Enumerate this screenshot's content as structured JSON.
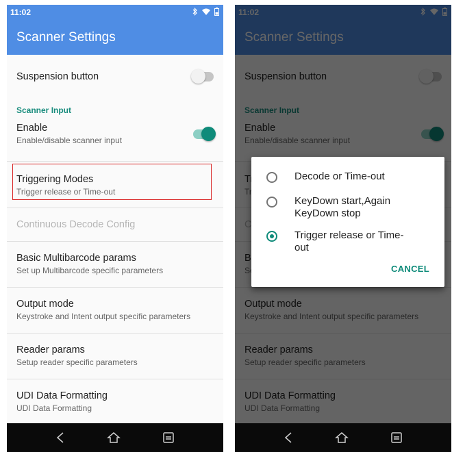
{
  "status_bar": {
    "time": "11:02",
    "icons": [
      "bluetooth-icon",
      "wifi-icon",
      "battery-icon"
    ]
  },
  "app_bar": {
    "title": "Scanner Settings"
  },
  "settings": {
    "suspension": {
      "title": "Suspension button",
      "enabled": false
    },
    "section_scanner_input": "Scanner Input",
    "enable": {
      "title": "Enable",
      "summary": "Enable/disable scanner input",
      "enabled": true
    },
    "triggering": {
      "title": "Triggering Modes",
      "summary": "Trigger release or Time-out"
    },
    "continuous": {
      "title": "Continuous Decode Config"
    },
    "multibarcode": {
      "title": "Basic Multibarcode params",
      "summary": "Set up Multibarcode specific parameters"
    },
    "output": {
      "title": "Output mode",
      "summary": "Keystroke and Intent output specific parameters"
    },
    "reader": {
      "title": "Reader params",
      "summary": "Setup reader specific parameters"
    },
    "udi": {
      "title": "UDI Data Formatting",
      "summary": "UDI Data Formatting"
    }
  },
  "dialog": {
    "options": [
      {
        "label": "Decode or Time-out",
        "selected": false
      },
      {
        "label": "KeyDown start,Again KeyDown stop",
        "selected": false
      },
      {
        "label": "Trigger release or Time-out",
        "selected": true
      }
    ],
    "cancel_label": "CANCEL"
  },
  "nav_bar": {
    "icons": [
      "back-icon",
      "home-icon",
      "recents-icon"
    ]
  },
  "colors": {
    "primary": "#4f8de4",
    "accent": "#0f8b7a",
    "highlight_border": "#d92626"
  }
}
